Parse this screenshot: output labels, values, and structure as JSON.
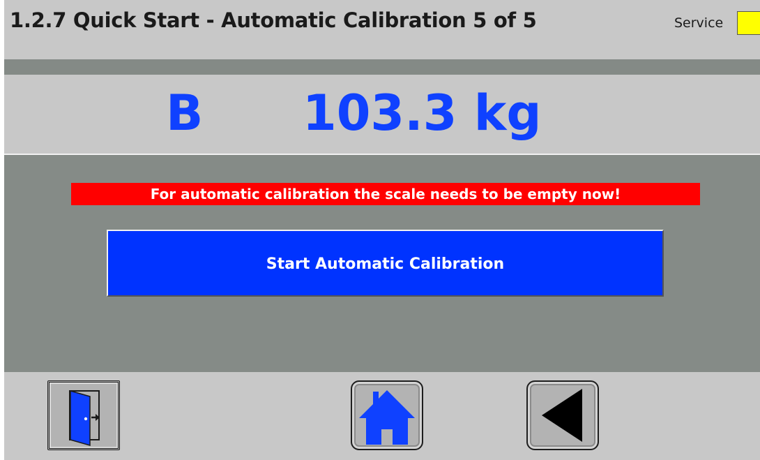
{
  "header": {
    "title": "1.2.7  Quick Start - Automatic Calibration 5 of 5",
    "service_label": "Service",
    "service_indicator_color": "#ffff00"
  },
  "weight": {
    "mode": "B",
    "value": "103.3 kg",
    "color": "#0f41ff"
  },
  "content": {
    "warning": "For automatic calibration the scale needs to be empty now!",
    "start_button": "Start Automatic Calibration"
  },
  "footer": {
    "buttons": [
      {
        "name": "exit",
        "icon": "exit-door-icon"
      },
      {
        "name": "home",
        "icon": "home-icon"
      },
      {
        "name": "back",
        "icon": "back-arrow-icon"
      }
    ]
  }
}
